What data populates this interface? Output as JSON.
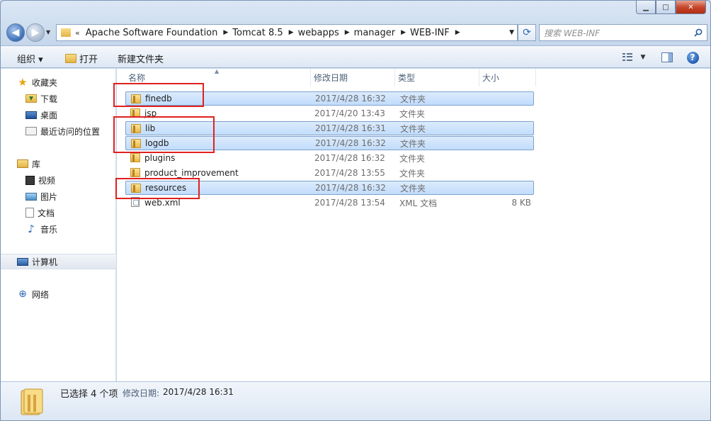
{
  "address": {
    "overflow_glyph": "«",
    "crumbs": [
      "Apache Software Foundation",
      "Tomcat 8.5",
      "webapps",
      "manager",
      "WEB-INF"
    ]
  },
  "search": {
    "placeholder": "搜索 WEB-INF"
  },
  "toolbar": {
    "organize_label": "组织 ▾",
    "open_label": "打开",
    "new_folder_label": "新建文件夹",
    "help_glyph": "?"
  },
  "caption": {
    "minimize": "▁",
    "maximize": "□",
    "close": "✕"
  },
  "nav": {
    "favorites": {
      "label": "收藏夹",
      "items": [
        "下载",
        "桌面",
        "最近访问的位置"
      ]
    },
    "libraries": {
      "label": "库",
      "items": [
        "视频",
        "图片",
        "文档",
        "音乐"
      ]
    },
    "computer": "计算机",
    "network": "网络"
  },
  "columns": {
    "name": "名称",
    "date": "修改日期",
    "type": "类型",
    "size": "大小"
  },
  "files": [
    {
      "name": "finedb",
      "date": "2017/4/28 16:32",
      "type": "文件夹",
      "size": "",
      "icon": "folder-icon",
      "selected": true
    },
    {
      "name": "jsp",
      "date": "2017/4/20 13:43",
      "type": "文件夹",
      "size": "",
      "icon": "folder-icon",
      "selected": false
    },
    {
      "name": "lib",
      "date": "2017/4/28 16:31",
      "type": "文件夹",
      "size": "",
      "icon": "folder-icon",
      "selected": true
    },
    {
      "name": "logdb",
      "date": "2017/4/28 16:32",
      "type": "文件夹",
      "size": "",
      "icon": "folder-icon",
      "selected": true
    },
    {
      "name": "plugins",
      "date": "2017/4/28 16:32",
      "type": "文件夹",
      "size": "",
      "icon": "folder-icon",
      "selected": false
    },
    {
      "name": "product_improvement",
      "date": "2017/4/28 13:55",
      "type": "文件夹",
      "size": "",
      "icon": "folder-icon",
      "selected": false
    },
    {
      "name": "resources",
      "date": "2017/4/28 16:32",
      "type": "文件夹",
      "size": "",
      "icon": "folder-icon",
      "selected": true
    },
    {
      "name": "web.xml",
      "date": "2017/4/28 13:54",
      "type": "XML 文档",
      "size": "8 KB",
      "icon": "xml-file-icon",
      "selected": false
    }
  ],
  "details": {
    "selection": "已选择 4 个项",
    "modified_label": "修改日期:",
    "modified_value": "2017/4/28 16:31"
  },
  "colors": {
    "highlight_box": "#e02020",
    "selection_fill": "#cde3fb"
  }
}
